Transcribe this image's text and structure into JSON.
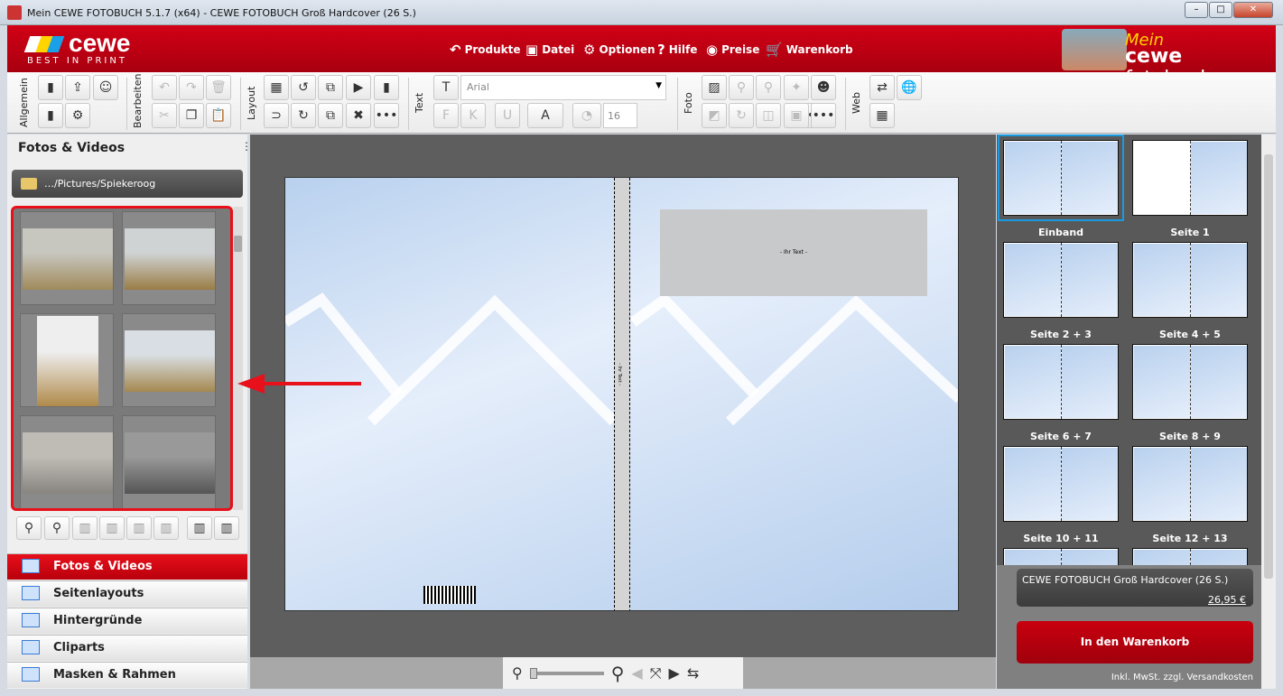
{
  "window": {
    "title": "Mein CEWE FOTOBUCH 5.1.7 (x64) - CEWE FOTOBUCH Groß Hardcover  (26 S.)",
    "controls": [
      "minimize",
      "maximize",
      "close"
    ]
  },
  "header": {
    "logo": "cewe",
    "tagline": "BEST IN PRINT",
    "brand_right": "Mein cewe fotobuch",
    "menu": [
      {
        "label": "Produkte",
        "icon": "produkte-icon"
      },
      {
        "label": "Datei",
        "icon": "datei-icon"
      },
      {
        "label": "Optionen",
        "icon": "gear-icon"
      },
      {
        "label": "Hilfe",
        "icon": "question-icon"
      },
      {
        "label": "Preise",
        "icon": "preise-icon"
      },
      {
        "label": "Warenkorb",
        "icon": "cart-icon"
      }
    ],
    "accent": "#c0000f"
  },
  "toolbar": {
    "groups": [
      "Allgemein",
      "Bearbeiten",
      "Layout",
      "Text",
      "Foto",
      "Web"
    ],
    "font": "Arial",
    "font_size": "16",
    "bold": "F",
    "italic": "K",
    "underline": "U",
    "color_label": "A",
    "more": "•••"
  },
  "left_panel": {
    "title": "Fotos & Videos",
    "folder": "…/Pictures/Spiekeroog",
    "nav": [
      {
        "label": "Fotos & Videos",
        "active": true
      },
      {
        "label": "Seitenlayouts"
      },
      {
        "label": "Hintergründe"
      },
      {
        "label": "Cliparts"
      },
      {
        "label": "Masken & Rahmen"
      }
    ]
  },
  "canvas": {
    "text_placeholder": "- Ihr Text -",
    "spine_text": "- Ihr Text -"
  },
  "pages": [
    "Einband",
    "Seite 1",
    "Seite 2 + 3",
    "Seite 4 + 5",
    "Seite 6 + 7",
    "Seite 8 + 9",
    "Seite 10 + 11",
    "Seite 12 + 13",
    "",
    ""
  ],
  "cart": {
    "product": "CEWE FOTOBUCH Groß Hardcover  (26 S.)",
    "price": "26,95 €",
    "button": "In den Warenkorb",
    "note": "Inkl. MwSt. zzgl. Versandkosten"
  }
}
